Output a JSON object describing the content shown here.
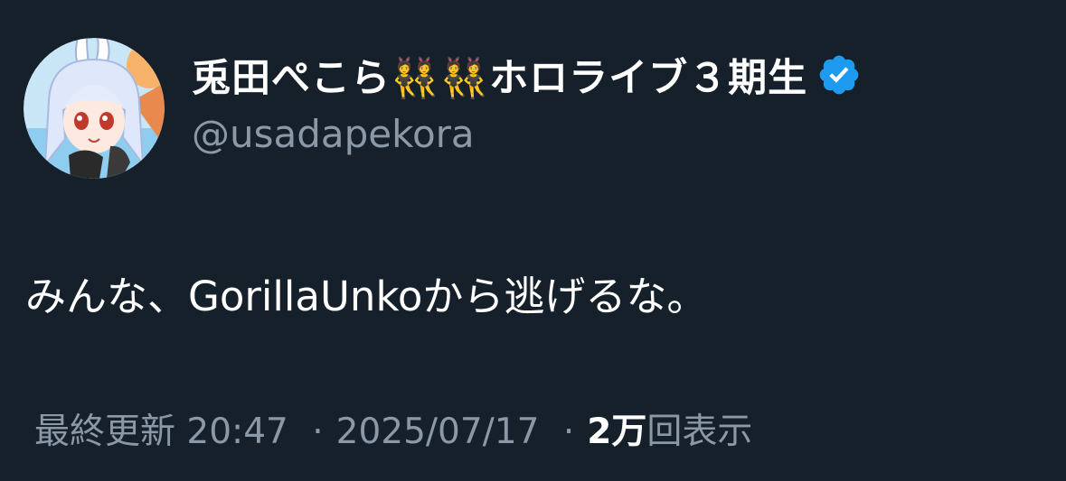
{
  "author": {
    "display_name": "兎田ぺこら👯👯ホロライブ３期生",
    "handle": "@usadapekora",
    "avatar_icon": "user-avatar-anime-bunny-girl",
    "verified_icon": "verified-badge-icon"
  },
  "tweet": {
    "text": "みんな、GorillaUnkoから逃げるな。"
  },
  "meta": {
    "prefix": "最終更新",
    "time": "20:47",
    "separator": "·",
    "date": "2025/07/17",
    "views_count": "2万",
    "views_label": "回表示"
  },
  "colors": {
    "background": "#15202b",
    "primary_text": "#ffffff",
    "secondary_text": "#8b98a5",
    "verified": "#1d9bf0"
  }
}
